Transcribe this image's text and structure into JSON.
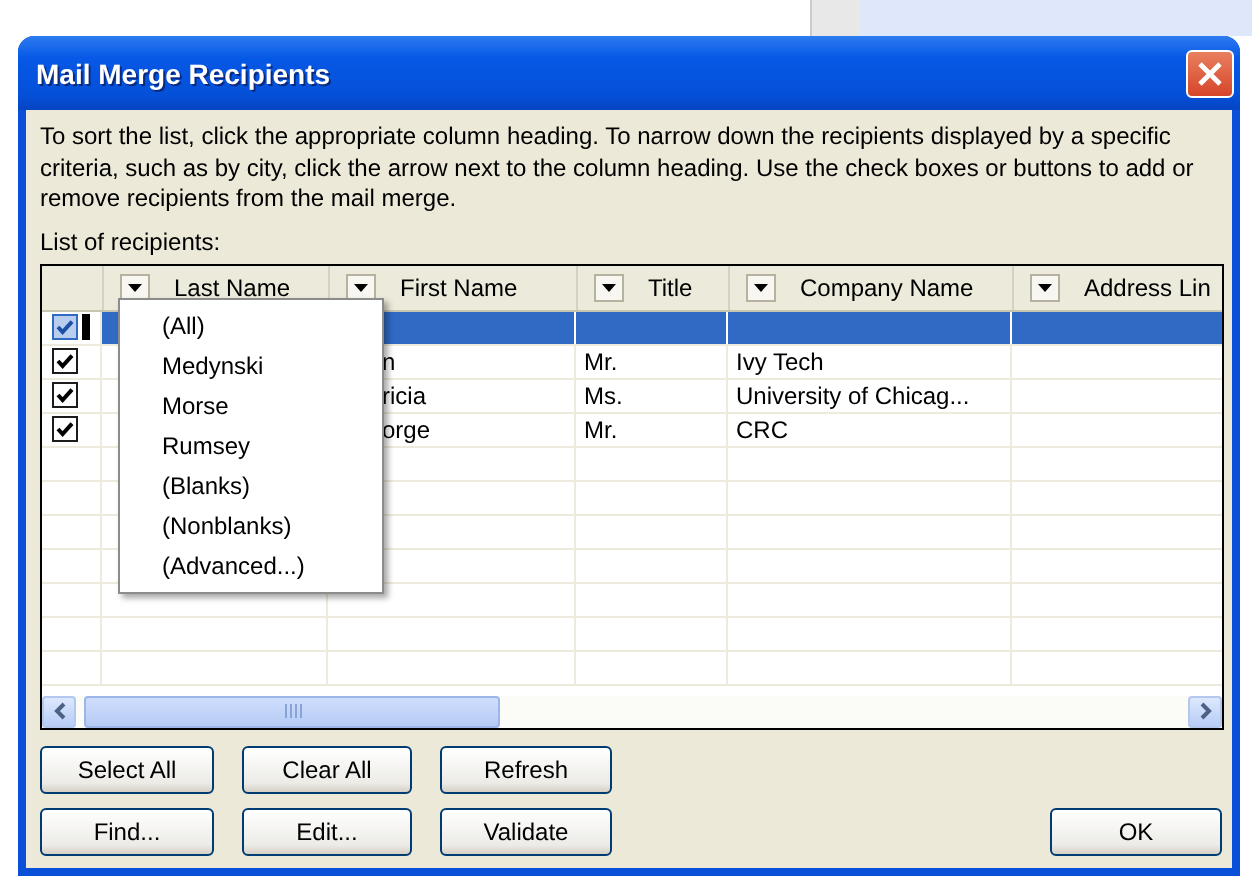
{
  "window": {
    "title": "Mail Merge Recipients"
  },
  "instructions": "To sort the list, click the appropriate column heading.  To narrow down the recipients displayed by a specific criteria, such as by city, click the arrow next to the column heading.  Use the check boxes or buttons to add or remove recipients from the mail merge.",
  "list_label": {
    "text": "List of recipients:"
  },
  "table": {
    "columns": [
      {
        "label": "Last Name"
      },
      {
        "label": "First Name"
      },
      {
        "label": "Title"
      },
      {
        "label": "Company Name"
      },
      {
        "label": "Address Lin"
      }
    ],
    "rows": [
      {
        "checked": true,
        "selected": true,
        "cells": [
          null,
          null,
          null,
          null,
          null
        ]
      },
      {
        "checked": true,
        "selected": false,
        "cells": [
          null,
          "n",
          "Mr.",
          "Ivy Tech",
          null
        ]
      },
      {
        "checked": true,
        "selected": false,
        "cells": [
          null,
          "ricia",
          "Ms.",
          "University of Chicag...",
          null
        ]
      },
      {
        "checked": true,
        "selected": false,
        "cells": [
          null,
          "orge",
          "Mr.",
          "CRC",
          null
        ]
      }
    ]
  },
  "filter_menu": {
    "items": [
      "(All)",
      "Medynski",
      "Morse",
      "Rumsey",
      "(Blanks)",
      "(Nonblanks)",
      "(Advanced...)"
    ]
  },
  "buttons": [
    {
      "label": "Select All"
    },
    {
      "label": "Clear All"
    },
    {
      "label": "Refresh"
    },
    {
      "label": "Find..."
    },
    {
      "label": "Edit..."
    },
    {
      "label": "Validate"
    }
  ],
  "ok_button": {
    "label": "OK"
  }
}
